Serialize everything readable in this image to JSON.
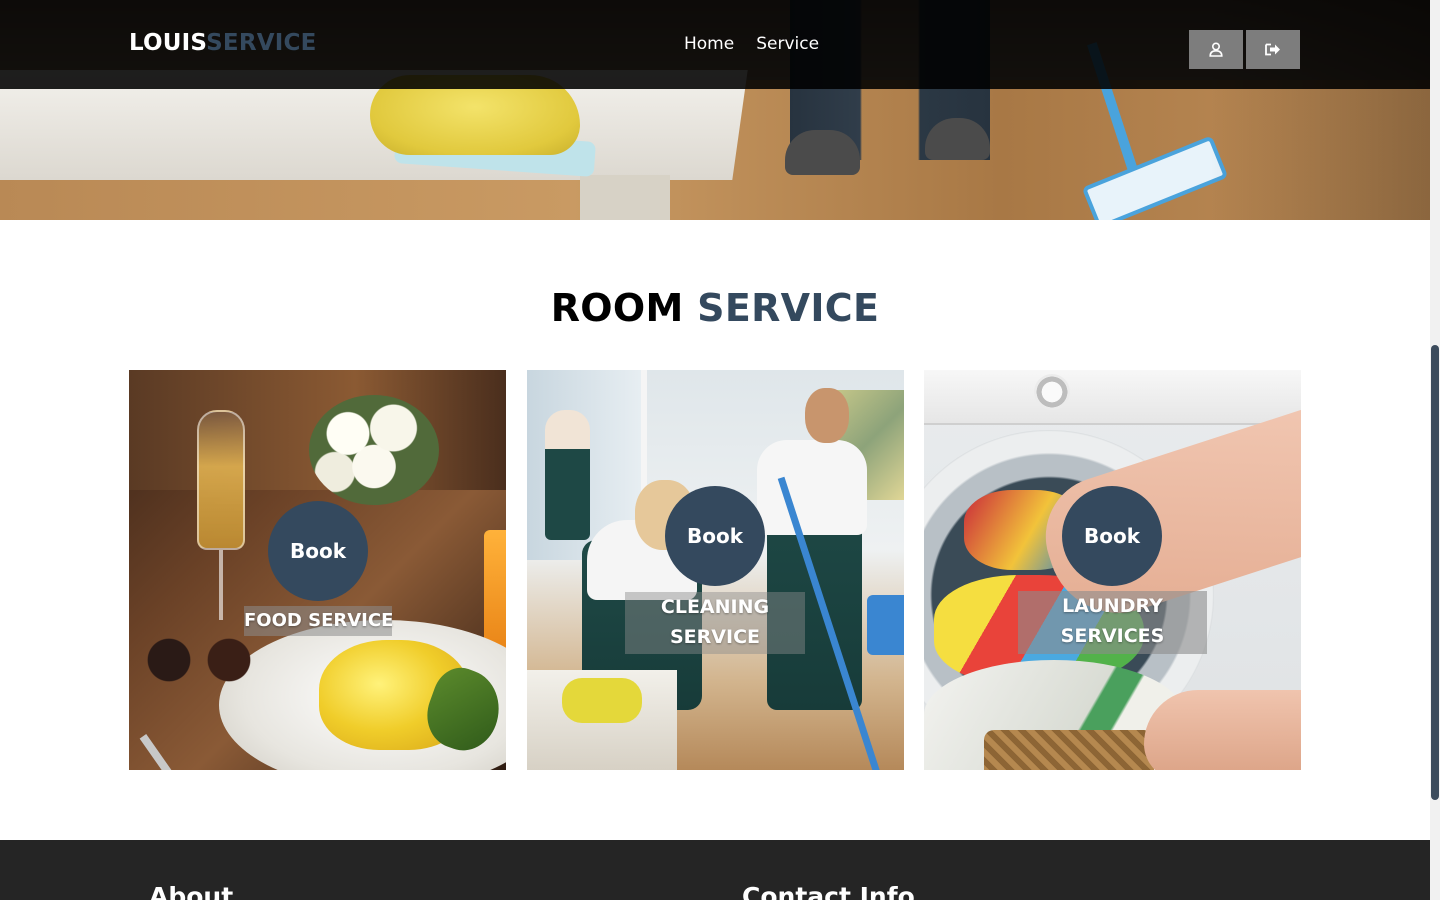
{
  "brand": {
    "part1": "LOUIS",
    "part2": "SERVICE",
    "accent": "#34495e"
  },
  "nav": {
    "links": [
      {
        "label": "Home"
      },
      {
        "label": "Service"
      }
    ],
    "buttons": [
      {
        "icon": "user-icon"
      },
      {
        "icon": "logout-icon"
      }
    ]
  },
  "section": {
    "title_part1": "ROOM",
    "title_part2": "SERVICE"
  },
  "cards": [
    {
      "action": "Book",
      "label": "FOOD SERVICE"
    },
    {
      "action": "Book",
      "label_line1": "CLEANING",
      "label_line2": "SERVICE"
    },
    {
      "action": "Book",
      "label_line1": "LAUNDRY",
      "label_line2": "SERVICES"
    }
  ],
  "footer": {
    "about_heading": "About",
    "contact_heading": "Contact Info"
  },
  "colors": {
    "navbar": "#000000",
    "button_bg": "#7d7d7d",
    "footer": "#252525"
  }
}
